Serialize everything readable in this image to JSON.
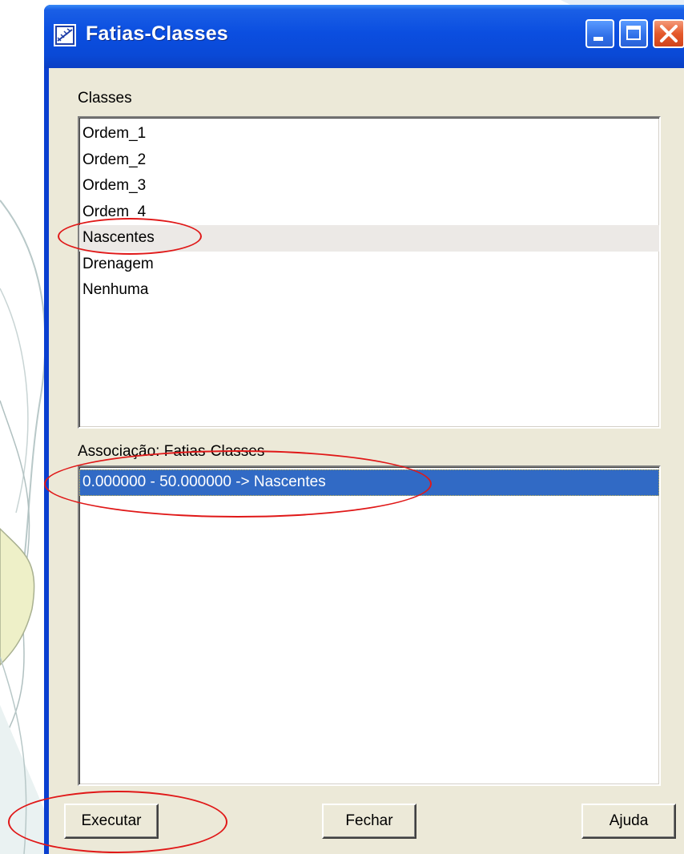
{
  "window": {
    "title": "Fatias-Classes"
  },
  "classes": {
    "label": "Classes",
    "items": [
      "Ordem_1",
      "Ordem_2",
      "Ordem_3",
      "Ordem_4",
      "Nascentes",
      "Drenagem",
      "Nenhuma"
    ],
    "highlighted_index": 4
  },
  "association": {
    "label": "Associação: Fatias-Classes",
    "items": [
      "0.000000 - 50.000000 -> Nascentes"
    ],
    "selected_index": 0
  },
  "buttons": {
    "execute": "Executar",
    "close": "Fechar",
    "help": "Ajuda"
  },
  "colors": {
    "title_bar": "#0a49d6",
    "selection": "#316ac5",
    "annotation": "#e01818",
    "dialog_face": "#ece9d8"
  }
}
